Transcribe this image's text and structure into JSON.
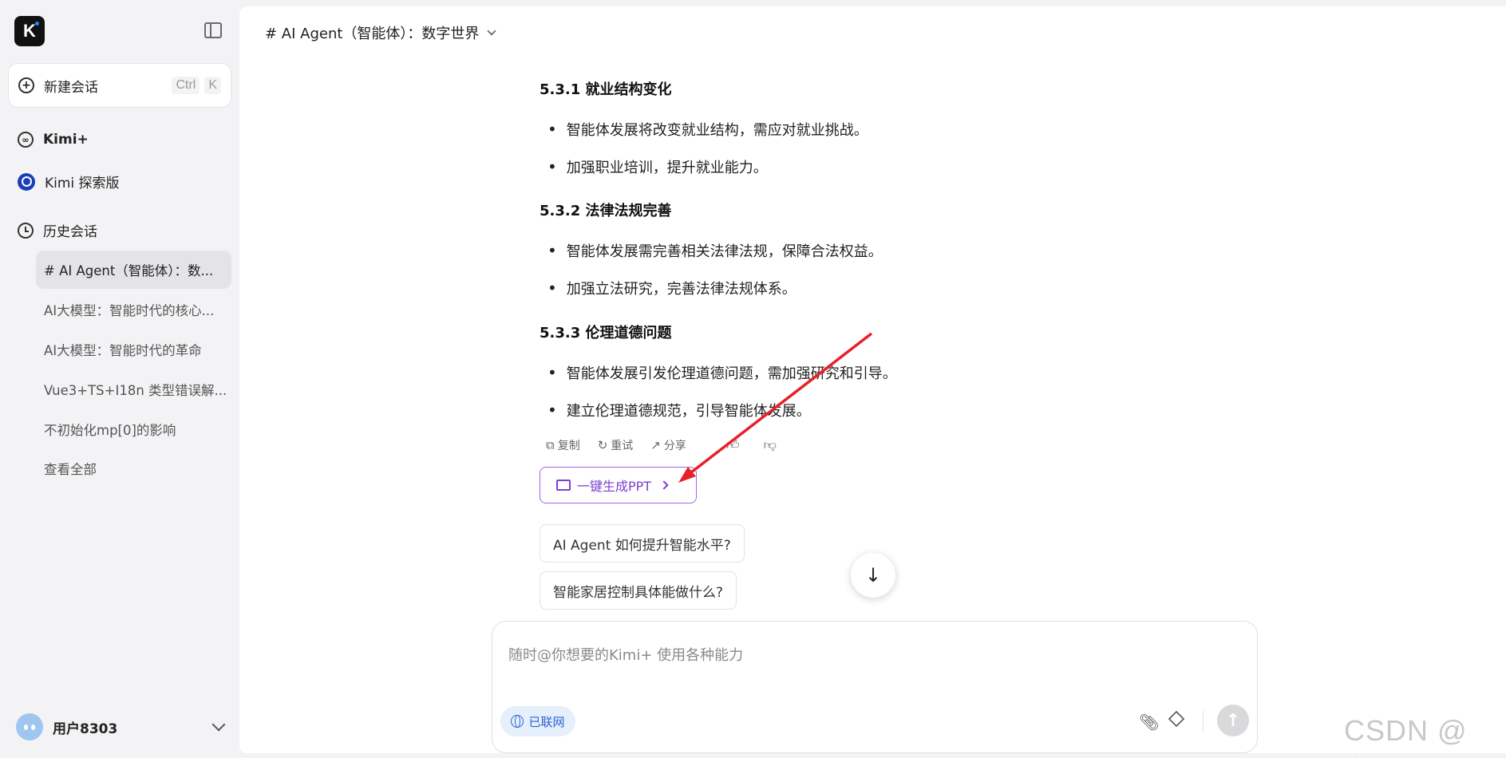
{
  "sidebar": {
    "new_chat_label": "新建会话",
    "shortcut": [
      "Ctrl",
      "K"
    ],
    "nav": [
      {
        "label": "Kimi+"
      },
      {
        "label": "Kimi 探索版"
      }
    ],
    "history_title": "历史会话",
    "history": [
      "# AI Agent（智能体）：数...",
      "AI大模型：智能时代的核心...",
      "AI大模型：智能时代的革命",
      "Vue3+TS+I18n 类型错误解...",
      "不初始化mp[0]的影响",
      "查看全部"
    ],
    "user_name": "用户8303"
  },
  "header": {
    "title": "# AI Agent（智能体）：数字世界"
  },
  "content": {
    "sections": [
      {
        "heading_num": "5.3.1 ",
        "heading": "就业结构变化",
        "bullets": [
          "智能体发展将改变就业结构，需应对就业挑战。",
          "加强职业培训，提升就业能力。"
        ]
      },
      {
        "heading_num": "5.3.2 ",
        "heading": "法律法规完善",
        "bullets": [
          "智能体发展需完善相关法律法规，保障合法权益。",
          "加强立法研究，完善法律法规体系。"
        ]
      },
      {
        "heading_num": "5.3.3 ",
        "heading": "伦理道德问题",
        "bullets": [
          "智能体发展引发伦理道德问题，需加强研究和引导。",
          "建立伦理道德规范，引导智能体发展。"
        ]
      }
    ],
    "actions": {
      "copy": "复制",
      "retry": "重试",
      "share": "分享"
    },
    "ppt_button": "一键生成PPT",
    "suggestions": [
      "AI Agent 如何提升智能水平?",
      "智能家居控制具体能做什么?"
    ]
  },
  "composer": {
    "placeholder": "随时@你想要的Kimi+ 使用各种能力",
    "net_label": "已联网"
  },
  "annotation": {
    "color": "#e8202a"
  },
  "watermark": "CSDN @心.c",
  "colors": {
    "accent_purple": "#7a3fd0",
    "link_blue": "#2a63d4",
    "sidebar_bg": "#f3f3f5"
  }
}
